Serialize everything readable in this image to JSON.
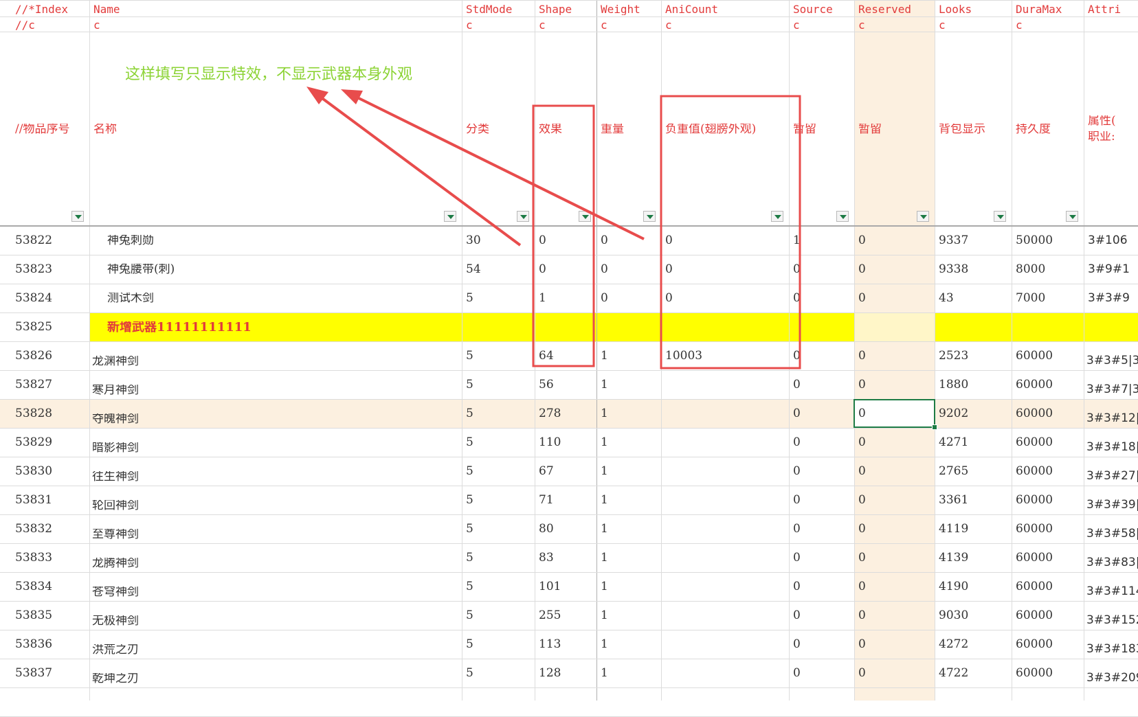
{
  "header": {
    "row1": [
      "//*Index",
      "Name",
      "StdMode",
      "Shape",
      "Weight",
      "AniCount",
      "Source",
      "Reserved",
      "Looks",
      "DuraMax",
      "Attri"
    ],
    "row2": [
      "//c",
      "c",
      "c",
      "c",
      "c",
      "c",
      "c",
      "c",
      "c",
      "c",
      ""
    ],
    "row3": [
      "//物品序号",
      "名称",
      "分类",
      "效果",
      "重量",
      "负重值(翅膀外观)",
      "暂留",
      "暂留",
      "背包显示",
      "持久度",
      "属性("
    ],
    "row3b": "职业:"
  },
  "annotation": {
    "text": "这样填写只显示特效，不显示武器本身外观",
    "color": "#8cd335"
  },
  "colors": {
    "header_text": "#e23b3b",
    "highlight_row": "#ffff00",
    "reserved_col": "#fcf0e0",
    "selection": "#1e7c45",
    "annotation_box": "#e84c4c"
  },
  "rows": [
    {
      "index": "53822",
      "name": "神兔刺勋",
      "stdmode": "30",
      "shape": "0",
      "weight": "0",
      "anicount": "0",
      "source": "1",
      "reserved": "0",
      "looks": "9337",
      "duramax": "50000",
      "attri": "3#106"
    },
    {
      "index": "53823",
      "name": "神兔腰带(刺)",
      "stdmode": "54",
      "shape": "0",
      "weight": "0",
      "anicount": "0",
      "source": "0",
      "reserved": "0",
      "looks": "9338",
      "duramax": "8000",
      "attri": "3#9#1"
    },
    {
      "index": "53824",
      "name": "测试木剑",
      "stdmode": "5",
      "shape": "1",
      "weight": "0",
      "anicount": "0",
      "source": "0",
      "reserved": "0",
      "looks": "43",
      "duramax": "7000",
      "attri": "3#3#9"
    },
    {
      "index": "53825",
      "name": "新增武器11111111111",
      "stdmode": "",
      "shape": "",
      "weight": "",
      "anicount": "",
      "source": "",
      "reserved": "",
      "looks": "",
      "duramax": "",
      "attri": ""
    },
    {
      "index": "53826",
      "name": "龙渊神剑",
      "stdmode": "5",
      "shape": "64",
      "weight": "1",
      "anicount": "10003",
      "source": "0",
      "reserved": "0",
      "looks": "2523",
      "duramax": "60000",
      "attri": "3#3#5|3"
    },
    {
      "index": "53827",
      "name": "寒月神剑",
      "stdmode": "5",
      "shape": "56",
      "weight": "1",
      "anicount": "",
      "source": "0",
      "reserved": "0",
      "looks": "1880",
      "duramax": "60000",
      "attri": "3#3#7|3"
    },
    {
      "index": "53828",
      "name": "夺魄神剑",
      "stdmode": "5",
      "shape": "278",
      "weight": "1",
      "anicount": "",
      "source": "0",
      "reserved": "0",
      "looks": "9202",
      "duramax": "60000",
      "attri": "3#3#12|"
    },
    {
      "index": "53829",
      "name": "暗影神剑",
      "stdmode": "5",
      "shape": "110",
      "weight": "1",
      "anicount": "",
      "source": "0",
      "reserved": "0",
      "looks": "4271",
      "duramax": "60000",
      "attri": "3#3#18|"
    },
    {
      "index": "53830",
      "name": "往生神剑",
      "stdmode": "5",
      "shape": "67",
      "weight": "1",
      "anicount": "",
      "source": "0",
      "reserved": "0",
      "looks": "2765",
      "duramax": "60000",
      "attri": "3#3#27|"
    },
    {
      "index": "53831",
      "name": "轮回神剑",
      "stdmode": "5",
      "shape": "71",
      "weight": "1",
      "anicount": "",
      "source": "0",
      "reserved": "0",
      "looks": "3361",
      "duramax": "60000",
      "attri": "3#3#39|"
    },
    {
      "index": "53832",
      "name": "至尊神剑",
      "stdmode": "5",
      "shape": "80",
      "weight": "1",
      "anicount": "",
      "source": "0",
      "reserved": "0",
      "looks": "4119",
      "duramax": "60000",
      "attri": "3#3#58|"
    },
    {
      "index": "53833",
      "name": "龙腾神剑",
      "stdmode": "5",
      "shape": "83",
      "weight": "1",
      "anicount": "",
      "source": "0",
      "reserved": "0",
      "looks": "4139",
      "duramax": "60000",
      "attri": "3#3#83|"
    },
    {
      "index": "53834",
      "name": "苍穹神剑",
      "stdmode": "5",
      "shape": "101",
      "weight": "1",
      "anicount": "",
      "source": "0",
      "reserved": "0",
      "looks": "4190",
      "duramax": "60000",
      "attri": "3#3#114"
    },
    {
      "index": "53835",
      "name": "无极神剑",
      "stdmode": "5",
      "shape": "255",
      "weight": "1",
      "anicount": "",
      "source": "0",
      "reserved": "0",
      "looks": "9030",
      "duramax": "60000",
      "attri": "3#3#152"
    },
    {
      "index": "53836",
      "name": "洪荒之刃",
      "stdmode": "5",
      "shape": "113",
      "weight": "1",
      "anicount": "",
      "source": "0",
      "reserved": "0",
      "looks": "4272",
      "duramax": "60000",
      "attri": "3#3#183"
    },
    {
      "index": "53837",
      "name": "乾坤之刃",
      "stdmode": "5",
      "shape": "128",
      "weight": "1",
      "anicount": "",
      "source": "0",
      "reserved": "0",
      "looks": "4722",
      "duramax": "60000",
      "attri": "3#3#209"
    }
  ]
}
